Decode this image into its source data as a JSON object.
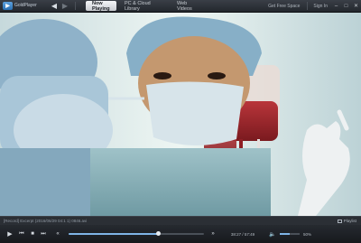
{
  "app": {
    "logo_text": "GoldPlayer",
    "tabs": [
      {
        "label": "Now Playing",
        "active": true
      },
      {
        "label": "PC & Cloud Library",
        "active": false
      },
      {
        "label": "Web Videos",
        "active": false
      }
    ],
    "get_free_space_label": "Get Free Space",
    "sign_in_label": "Sign In"
  },
  "infobar": {
    "filename": "[Record] Excerpt (2016/06/29 04:1 1) 0846.avi",
    "playlist_label": "Playlist"
  },
  "controls": {
    "time": "38:27 / 57:49",
    "progress": 0.665,
    "volume": 0.5,
    "volume_percent": "50%"
  },
  "colors": {
    "accent": "#7fb4e6",
    "titlebar": "#2b2f35"
  },
  "icons": {
    "back": "back-arrow-icon",
    "forward": "forward-arrow-icon",
    "play": "play-icon",
    "prev": "previous-icon",
    "stop": "stop-icon",
    "next": "next-icon",
    "volume": "speaker-icon"
  }
}
